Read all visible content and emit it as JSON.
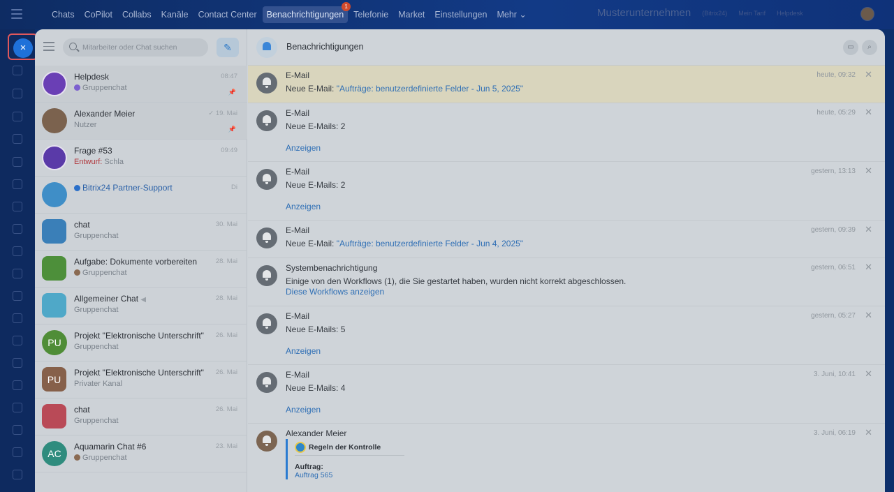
{
  "topbar": {
    "items": [
      "Chats",
      "CoPilot",
      "Collabs",
      "Kanäle",
      "Contact Center",
      "Benachrichtigungen",
      "Telefonie",
      "Market",
      "Einstellungen",
      "Mehr ⌄"
    ],
    "badge": "1",
    "company": "Musterunternehmen",
    "small1": "(Bitrix24)",
    "small2": "Mein Tarif",
    "small3": "Helpdesk"
  },
  "close_label": "×",
  "search": {
    "placeholder": "Mitarbeiter oder Chat suchen"
  },
  "compose_icon": "✎",
  "chats": [
    {
      "name": "Helpdesk",
      "sub": "Gruppenchat",
      "time": "08:47",
      "pin": "📌",
      "avatar_text": ""
    },
    {
      "name": "Alexander Meier",
      "sub": "Nutzer",
      "time": "✓ 19. Mai",
      "pin": "📌",
      "avatar_text": ""
    },
    {
      "name": "Frage #53",
      "draft": "Entwurf:",
      "sub": " Schla",
      "time": "09:49",
      "avatar_text": ""
    },
    {
      "name": "Bitrix24 Partner-Support",
      "sub": "",
      "time": "Di",
      "avatar_text": ""
    },
    {
      "name": "chat",
      "sub": "Gruppenchat",
      "time": "30. Mai",
      "avatar_text": ""
    },
    {
      "name": "Aufgabe: Dokumente vorbereiten",
      "sub": "Gruppenchat",
      "time": "28. Mai",
      "avatar_text": ""
    },
    {
      "name": "Allgemeiner Chat",
      "sub": "Gruppenchat",
      "time": "28. Mai",
      "avatar_text": ""
    },
    {
      "name": "Projekt \"Elektronische Unterschrift\"",
      "sub": "Gruppenchat",
      "time": "26. Mai",
      "avatar_text": "PU"
    },
    {
      "name": "Projekt \"Elektronische Unterschrift\"",
      "sub": "Privater Kanal",
      "time": "26. Mai",
      "avatar_text": "PU"
    },
    {
      "name": "chat",
      "sub": "Gruppenchat",
      "time": "26. Mai",
      "avatar_text": ""
    },
    {
      "name": "Aquamarin Chat #6",
      "sub": "Gruppenchat",
      "time": "23. Mai",
      "avatar_text": "AC"
    }
  ],
  "notifications_header": {
    "title": "Benachrichtigungen"
  },
  "notifications": [
    {
      "title": "E-Mail",
      "text": "Neue E-Mail: ",
      "link": "\"Aufträge: benutzerdefinierte Felder - Jun 5, 2025\"",
      "time": "heute, 09:32"
    },
    {
      "title": "E-Mail",
      "text": "Neue E-Mails: 2",
      "show": "Anzeigen",
      "time": "heute, 05:29"
    },
    {
      "title": "E-Mail",
      "text": "Neue E-Mails: 2",
      "show": "Anzeigen",
      "time": "gestern, 13:13"
    },
    {
      "title": "E-Mail",
      "text": "Neue E-Mail: ",
      "link": "\"Aufträge: benutzerdefinierte Felder - Jun 4, 2025\"",
      "time": "gestern, 09:39"
    },
    {
      "title": "Systembenachrichtigung",
      "text": "Einige von den Workflows (1), die Sie gestartet haben, wurden nicht korrekt abgeschlossen.",
      "link2": "Diese Workflows anzeigen",
      "time": "gestern, 06:51"
    },
    {
      "title": "E-Mail",
      "text": "Neue E-Mails: 5",
      "show": "Anzeigen",
      "time": "gestern, 05:27"
    },
    {
      "title": "E-Mail",
      "text": "Neue E-Mails: 4",
      "show": "Anzeigen",
      "time": "3. Juni, 10:41"
    },
    {
      "title": "Alexander Meier",
      "quote_title": "Regeln der Kontrolle",
      "quote_label": "Auftrag:",
      "quote_value": "Auftrag 565",
      "time": "3. Juni, 06:19"
    }
  ],
  "close_x": "✕"
}
